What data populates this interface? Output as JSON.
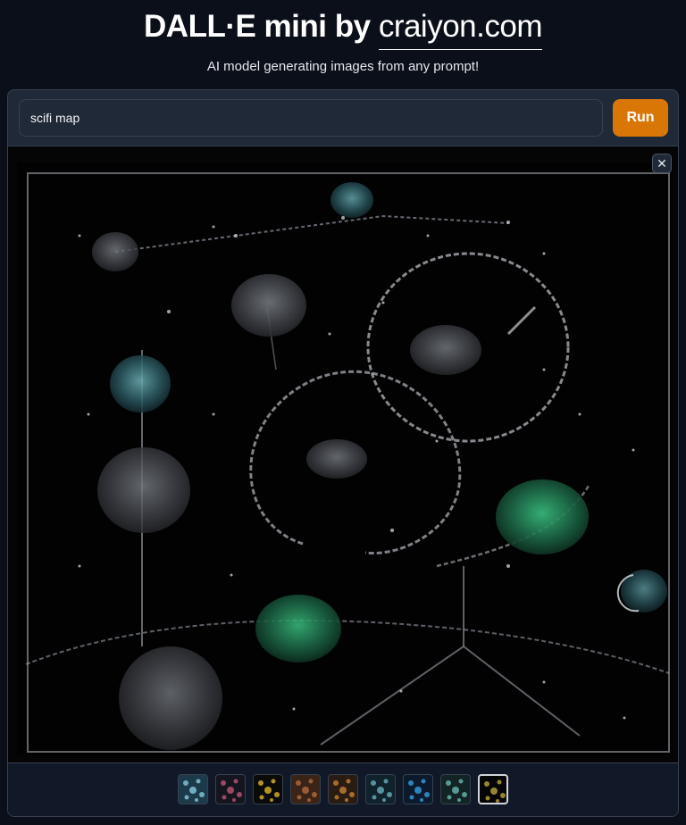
{
  "header": {
    "title_prefix": "DALL·E mini by",
    "title_link": "craiyon.com",
    "subtitle": "AI model generating images from any prompt!"
  },
  "prompt": {
    "value": "scifi map",
    "run_label": "Run"
  },
  "gallery": {
    "close_icon": "close-icon",
    "close_glyph": "✕",
    "thumbnails": [
      {
        "name": "thumbnail-1",
        "bg": "#1c3a4a",
        "accent": "#8fd3e8"
      },
      {
        "name": "thumbnail-2",
        "bg": "#15151f",
        "accent": "#c85a7a"
      },
      {
        "name": "thumbnail-3",
        "bg": "#0a0a08",
        "accent": "#e8c030"
      },
      {
        "name": "thumbnail-4",
        "bg": "#3a2418",
        "accent": "#b87040"
      },
      {
        "name": "thumbnail-5",
        "bg": "#2a1c12",
        "accent": "#d08838"
      },
      {
        "name": "thumbnail-6",
        "bg": "#10222c",
        "accent": "#6fb8c8"
      },
      {
        "name": "thumbnail-7",
        "bg": "#0c1a2e",
        "accent": "#38a8e8"
      },
      {
        "name": "thumbnail-8",
        "bg": "#122424",
        "accent": "#70c0b8"
      },
      {
        "name": "thumbnail-9",
        "bg": "#050505",
        "accent": "#c8b040",
        "selected": true
      }
    ]
  },
  "colors": {
    "background": "#0b0f19",
    "panel": "#1f2937",
    "accent": "#d97706"
  }
}
